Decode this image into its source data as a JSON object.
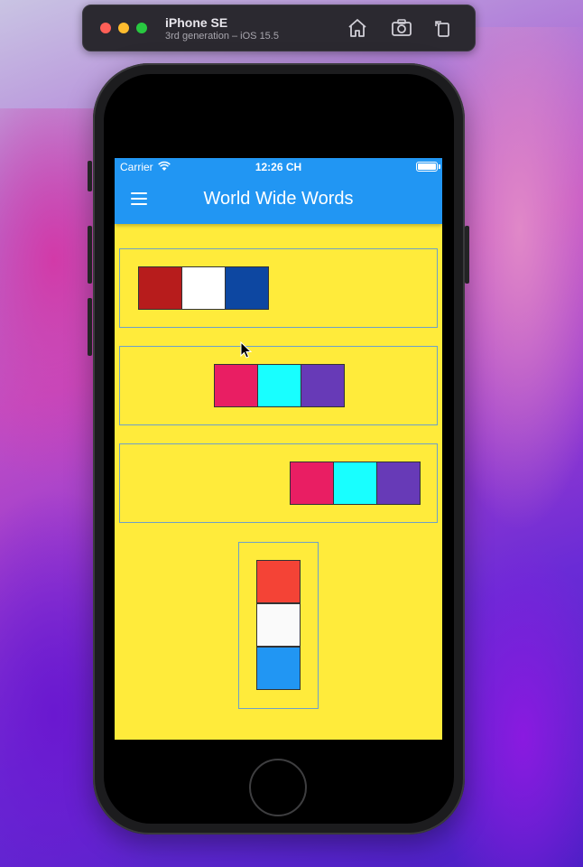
{
  "simulator": {
    "device_name": "iPhone SE",
    "device_subtitle": "3rd generation – iOS 15.5"
  },
  "status_bar": {
    "carrier": "Carrier",
    "time": "12:26 CH"
  },
  "app_bar": {
    "title": "World Wide Words"
  },
  "colors": {
    "app_bar": "#2196f3",
    "body_background": "#ffeb3b",
    "box_border": "#6ea0c8"
  },
  "flag_rows": [
    {
      "alignment": "start",
      "squares": [
        "#b71c1c",
        "#ffffff",
        "#0d47a1"
      ]
    },
    {
      "alignment": "center",
      "squares": [
        "#e91e63",
        "#18ffff",
        "#673ab7"
      ]
    },
    {
      "alignment": "end",
      "squares": [
        "#e91e63",
        "#18ffff",
        "#673ab7"
      ]
    }
  ],
  "flag_column": {
    "squares": [
      "#f44336",
      "#fafafa",
      "#2196f3"
    ]
  }
}
